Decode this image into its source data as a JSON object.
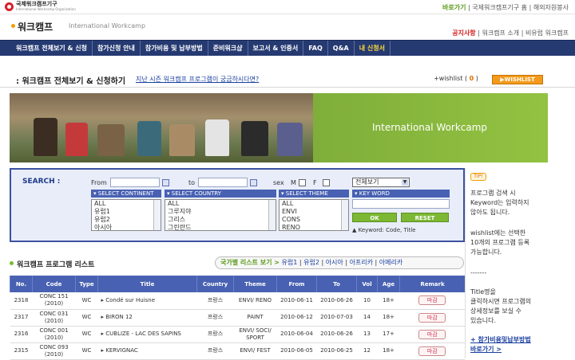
{
  "top": {
    "org_name": "국제워크캠프기구",
    "org_sub": "International Workcamp Organization",
    "links": [
      "바로가기",
      "국제워크캠프기구 홈",
      "해외자원봉사"
    ]
  },
  "brand": {
    "name": "워크캠프",
    "en": "International Workcamp",
    "links": [
      "공지사항",
      "워크캠프 소개",
      "비유럽 워크캠프"
    ]
  },
  "nav": [
    "워크캠프 전체보기 & 신청",
    "참가신청 안내",
    "참가비용 및 납부방법",
    "준비워크샵",
    "보고서 & 인증서",
    "FAQ",
    "Q&A",
    "내 신청서"
  ],
  "page": {
    "title": ": 워크캠프 전체보기 & 신청하기",
    "past_link": "지난 시즌 워크캠프 프로그램이 궁금하시다면?",
    "wishlist_label": "+wishlist ( ",
    "wishlist_count": "0",
    "wishlist_close": " )",
    "wishlist_btn": "WISHLIST"
  },
  "banner": {
    "title": "International Workcamp"
  },
  "search": {
    "label": "SEARCH :",
    "from": "From",
    "to": "to",
    "sex": "sex",
    "m": "M",
    "f": "F",
    "view_select": "전체보기",
    "continent_header": "SELECT CONTINENT",
    "country_header": "SELECT COUNTRY",
    "theme_header": "SELECT THEME",
    "keyword_header": "KEY WORD",
    "continents": [
      "ALL",
      "유럽1",
      "유럽2",
      "아시아"
    ],
    "countries": [
      "ALL",
      "그루지야",
      "그리스",
      "그린란드"
    ],
    "themes": [
      "ALL",
      "ENVI",
      "CONS",
      "RENO"
    ],
    "ok": "OK",
    "reset": "RESET",
    "keyword_hint": "▲ Keyword: Code, Title"
  },
  "tip": {
    "badge": "TIP!",
    "p1": [
      "프로그램 검색 시",
      "Keyword는 입력하지",
      "않아도 됩니다."
    ],
    "p2": [
      "wishlist에는 선택한",
      "10개의 프로그램 등록",
      "가능합니다."
    ],
    "sep": "-------",
    "p3": [
      "Title명을",
      "클릭하시면 프로그램의",
      "상세정보를 보실 수",
      "있습니다."
    ],
    "link": [
      "+ 참가비용및납부방법",
      "바로가기 >"
    ]
  },
  "list": {
    "title": "워크캠프 프로그램 리스트",
    "country_link": "국가별 리스트 보기 >",
    "regions": [
      "유럽1",
      "유럽2",
      "아시아",
      "아프리카",
      "아메리카"
    ]
  },
  "table": {
    "headers": [
      "No.",
      "Code",
      "Type",
      "Title",
      "Country",
      "Theme",
      "From",
      "To",
      "Vol",
      "Age",
      "Remark"
    ],
    "rows": [
      {
        "no": "2318",
        "code": "CONC 151 (2010)",
        "type": "WC",
        "title": "Condé sur Huisne",
        "country": "프랑스",
        "theme": "ENVI/ RENO",
        "from": "2010-06-11",
        "to": "2010-06-26",
        "vol": "10",
        "age": "18+",
        "remark": "마감"
      },
      {
        "no": "2317",
        "code": "CONC 031 (2010)",
        "type": "WC",
        "title": "BIRON 12",
        "country": "프랑스",
        "theme": "PAINT",
        "from": "2010-06-12",
        "to": "2010-07-03",
        "vol": "14",
        "age": "18+",
        "remark": "마감"
      },
      {
        "no": "2316",
        "code": "CONC 001 (2010)",
        "type": "WC",
        "title": "CUBLIZE - LAC DES SAPINS",
        "country": "프랑스",
        "theme": "ENVI/ SOCI/ SPORT",
        "from": "2010-06-04",
        "to": "2010-06-26",
        "vol": "13",
        "age": "17+",
        "remark": "마감"
      },
      {
        "no": "2315",
        "code": "CONC 093 (2010)",
        "type": "WC",
        "title": "KERVIGNAC",
        "country": "프랑스",
        "theme": "ENVI/ FEST",
        "from": "2010-06-05",
        "to": "2010-06-25",
        "vol": "12",
        "age": "18+",
        "remark": "마감"
      }
    ]
  }
}
